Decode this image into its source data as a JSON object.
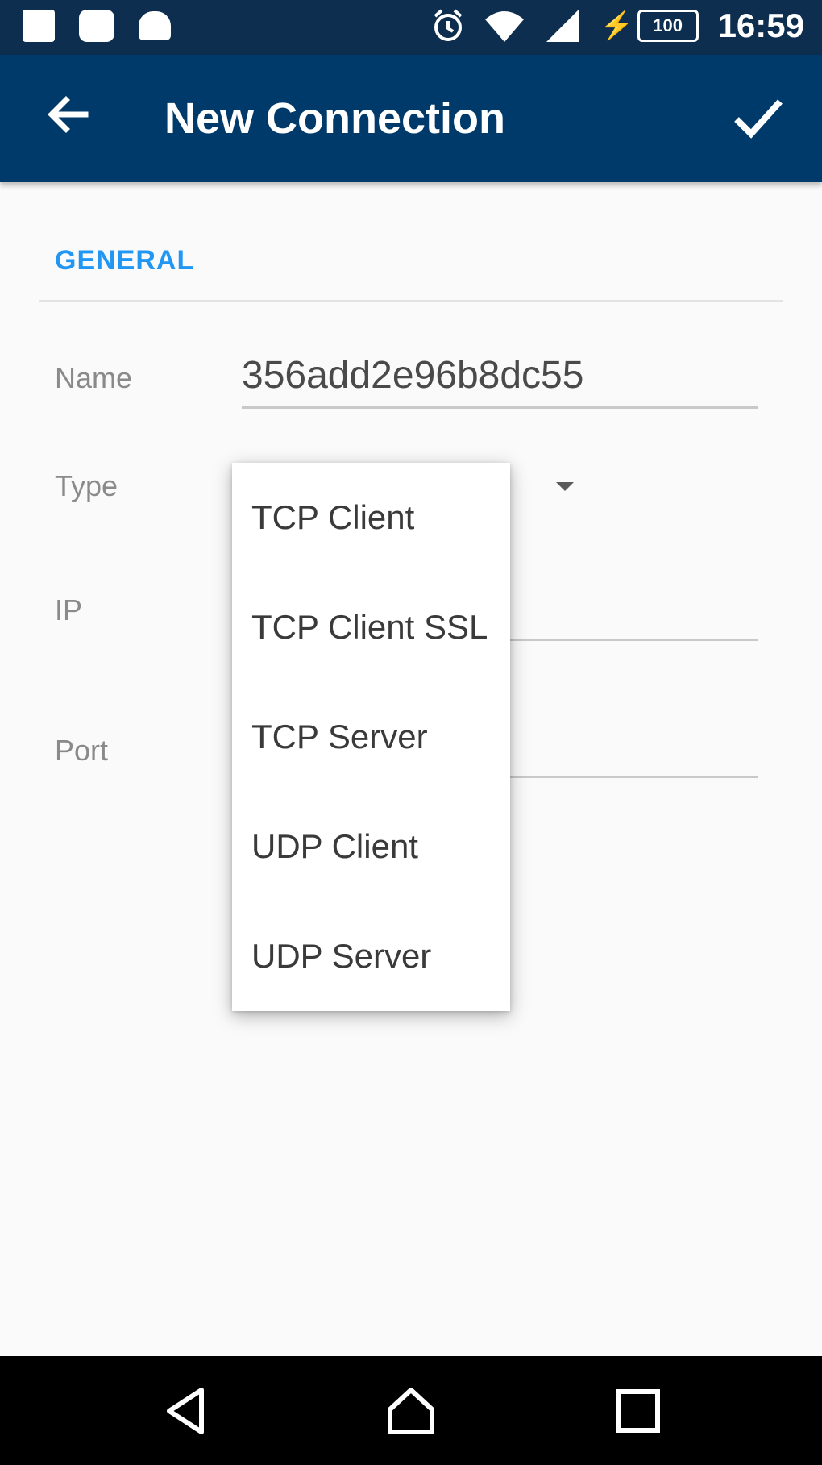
{
  "status_bar": {
    "time": "16:59",
    "battery_level": "100",
    "left_icons": [
      "image-icon",
      "chat-icon",
      "android-icon"
    ],
    "right_icons": [
      "alarm-icon",
      "wifi-icon",
      "signal-icon",
      "battery-icon"
    ]
  },
  "app_bar": {
    "title": "New Connection",
    "back_icon": "arrow-left-icon",
    "confirm_icon": "check-icon",
    "background": "#003a6a"
  },
  "form": {
    "section_title": "GENERAL",
    "fields": {
      "name": {
        "label": "Name",
        "value": "356add2e96b8dc55"
      },
      "type": {
        "label": "Type"
      },
      "ip": {
        "label": "IP"
      },
      "port": {
        "label": "Port"
      }
    }
  },
  "type_dropdown": {
    "options": [
      "TCP Client",
      "TCP Client SSL",
      "TCP Server",
      "UDP Client",
      "UDP Server"
    ]
  },
  "nav_bar": {
    "icons": [
      "back-triangle-icon",
      "home-icon",
      "recents-icon"
    ]
  },
  "colors": {
    "accent": "#2196f3",
    "status_bar": "#0d2e4e",
    "background": "#fafafa"
  }
}
